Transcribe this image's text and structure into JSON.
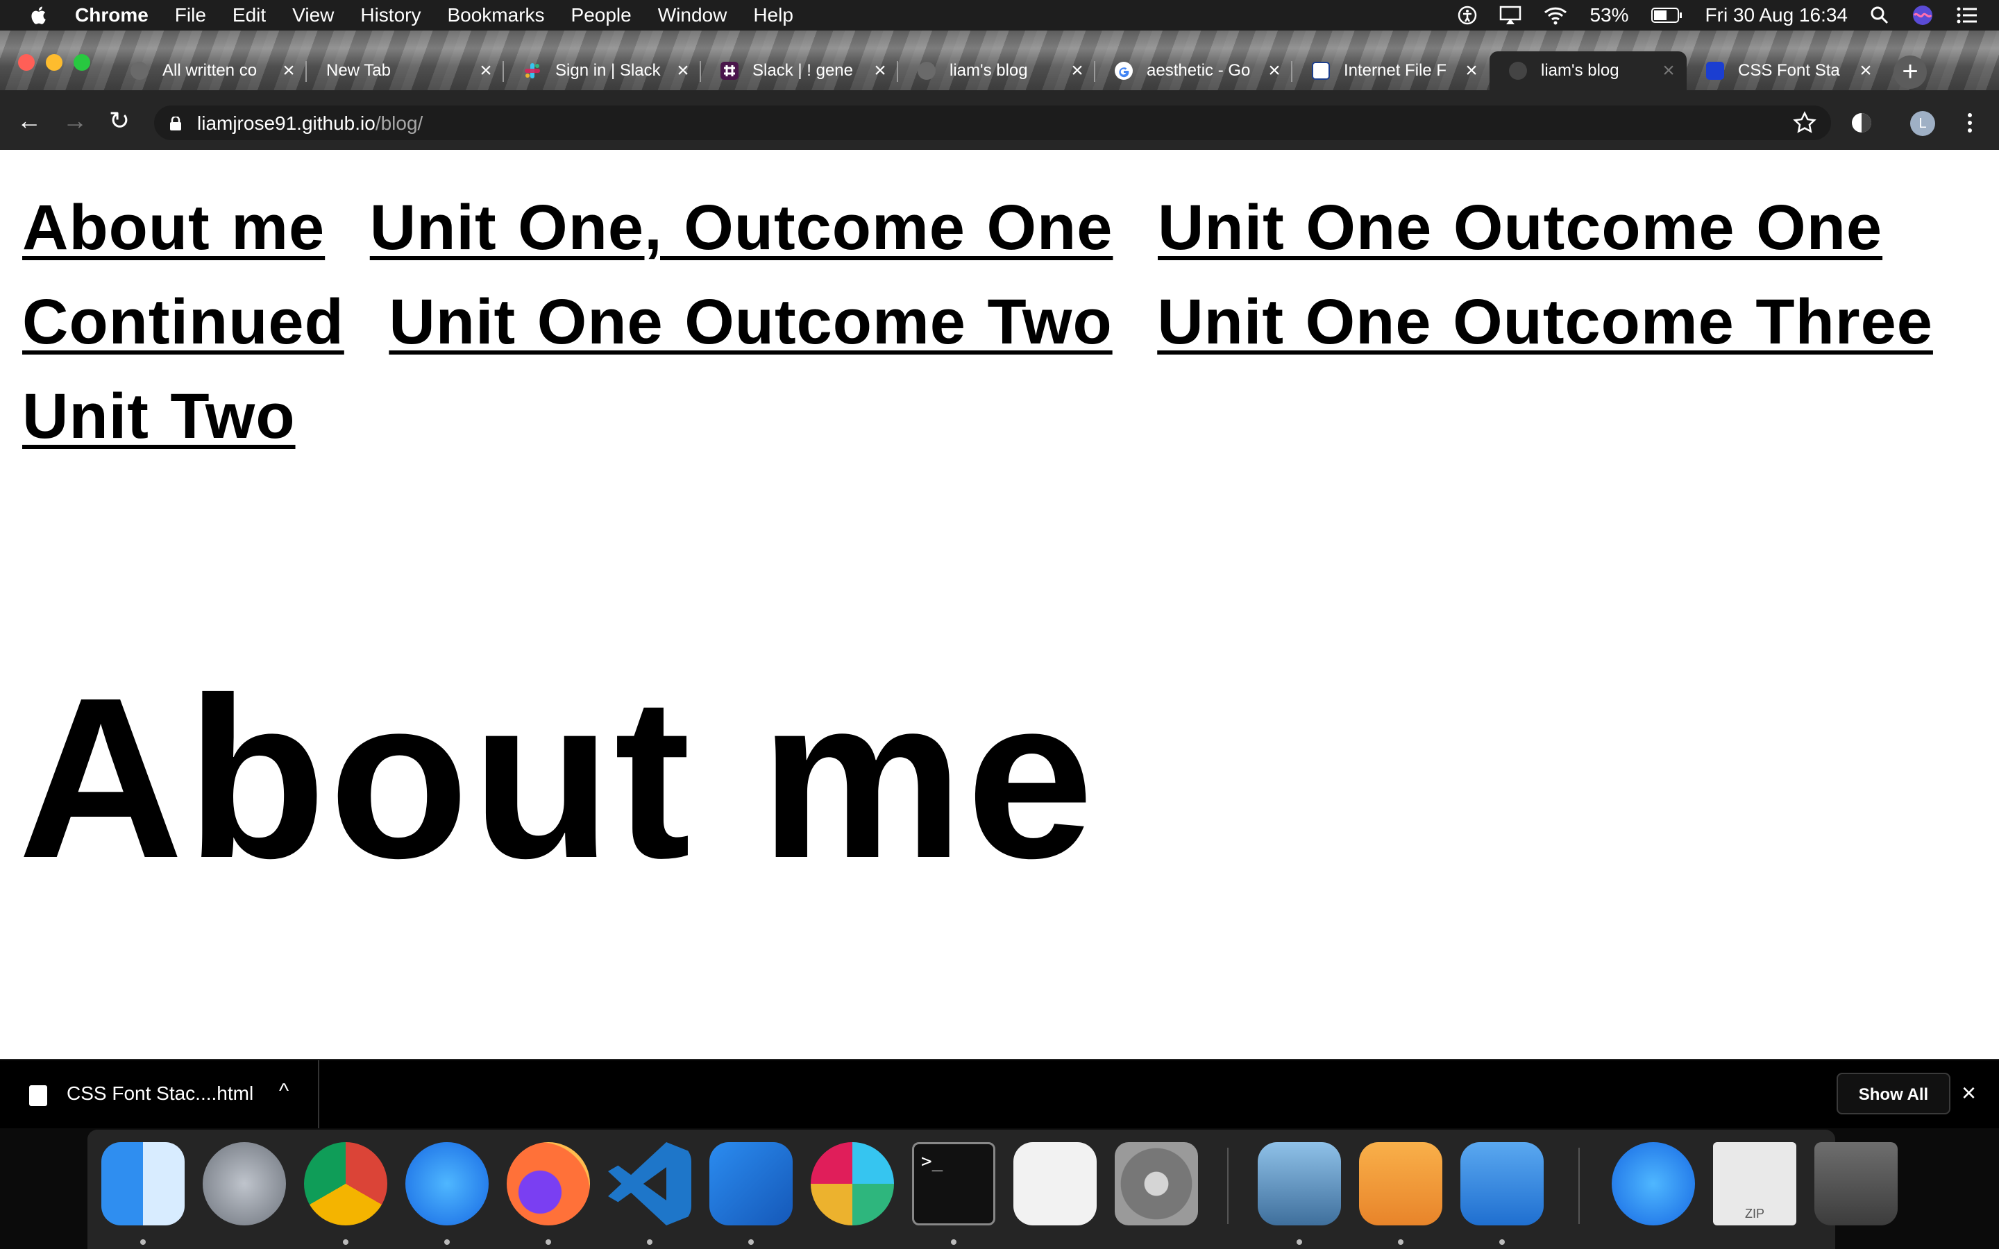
{
  "menubar": {
    "app_name": "Chrome",
    "menus": [
      "File",
      "Edit",
      "View",
      "History",
      "Bookmarks",
      "People",
      "Window",
      "Help"
    ],
    "battery": "53%",
    "datetime": "Fri 30 Aug  16:34"
  },
  "tabs": [
    {
      "title": "All written co",
      "favicon": "globe-icon"
    },
    {
      "title": "New Tab",
      "favicon": "none"
    },
    {
      "title": "Sign in | Slack",
      "favicon": "slack-icon"
    },
    {
      "title": "Slack | ! gene",
      "favicon": "slack-icon"
    },
    {
      "title": "liam's blog",
      "favicon": "globe-icon"
    },
    {
      "title": "aesthetic - Go",
      "favicon": "google-icon"
    },
    {
      "title": "Internet File F",
      "favicon": "html-icon"
    },
    {
      "title": "liam's blog",
      "favicon": "globe-icon",
      "active": true
    },
    {
      "title": "CSS Font Sta",
      "favicon": "dans-tools-icon"
    }
  ],
  "omnibox": {
    "host": "liamjrose91.github.io",
    "path": "/blog/"
  },
  "profile_initial": "L",
  "page": {
    "nav_links": [
      "About me",
      "Unit One, Outcome One",
      "Unit One Outcome One Continued",
      "Unit One Outcome Two",
      "Unit One Outcome Three",
      "Unit Two"
    ],
    "heading": "About me"
  },
  "download_shelf": {
    "file_name": "CSS Font Stac....html",
    "show_all_label": "Show All"
  },
  "dock": {
    "zip_label": "ZIP"
  },
  "colors": {
    "menubar": "#1e1e1e",
    "toolbar": "#262626",
    "dock": "#252525",
    "page_text": "#000000"
  }
}
